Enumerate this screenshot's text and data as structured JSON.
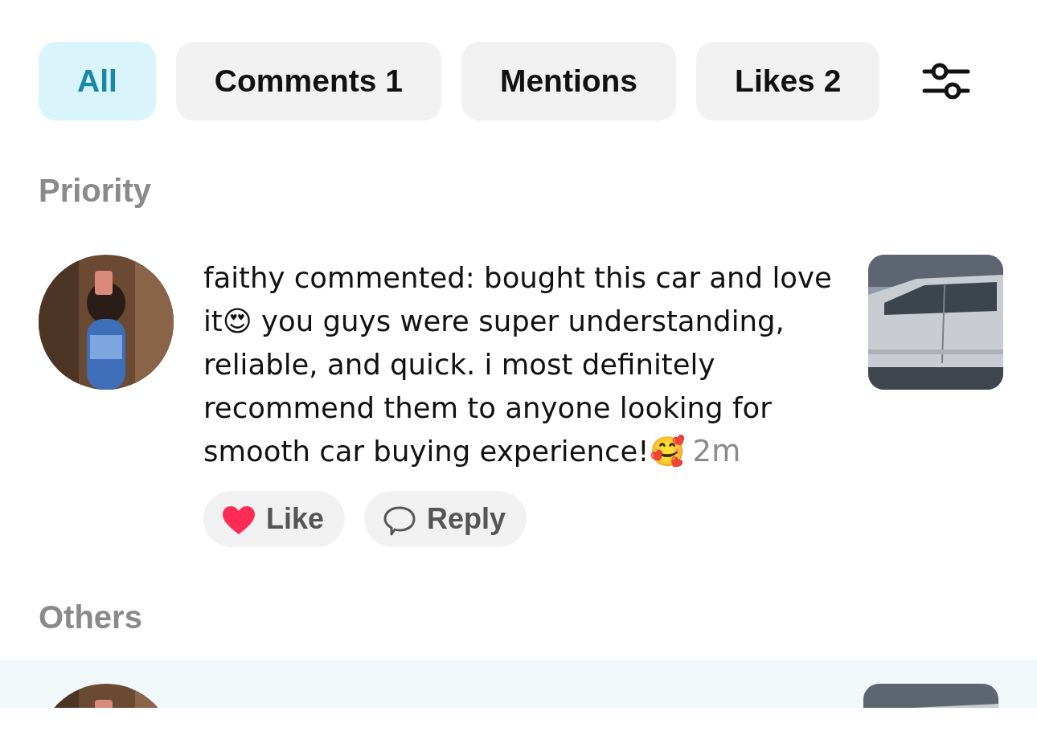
{
  "tabs": [
    {
      "label": "All",
      "selected": true
    },
    {
      "label": "Comments 1",
      "selected": false
    },
    {
      "label": "Mentions",
      "selected": false
    },
    {
      "label": "Likes 2",
      "selected": false
    }
  ],
  "sections": [
    {
      "title": "Priority",
      "items": [
        {
          "kind": "comment",
          "text": "faithy commented: bought this car and love it😍 you guys were super understanding, reliable, and quick. i most definitely recommend them to anyone looking for smooth car buying experience!🥰",
          "time": "2m",
          "liked": true,
          "actions": [
            {
              "kind": "like",
              "label": "Like"
            },
            {
              "kind": "reply",
              "label": "Reply"
            }
          ],
          "highlighted": false
        }
      ]
    },
    {
      "title": "Others",
      "items": [
        {
          "kind": "partial",
          "highlighted": true
        }
      ]
    }
  ]
}
